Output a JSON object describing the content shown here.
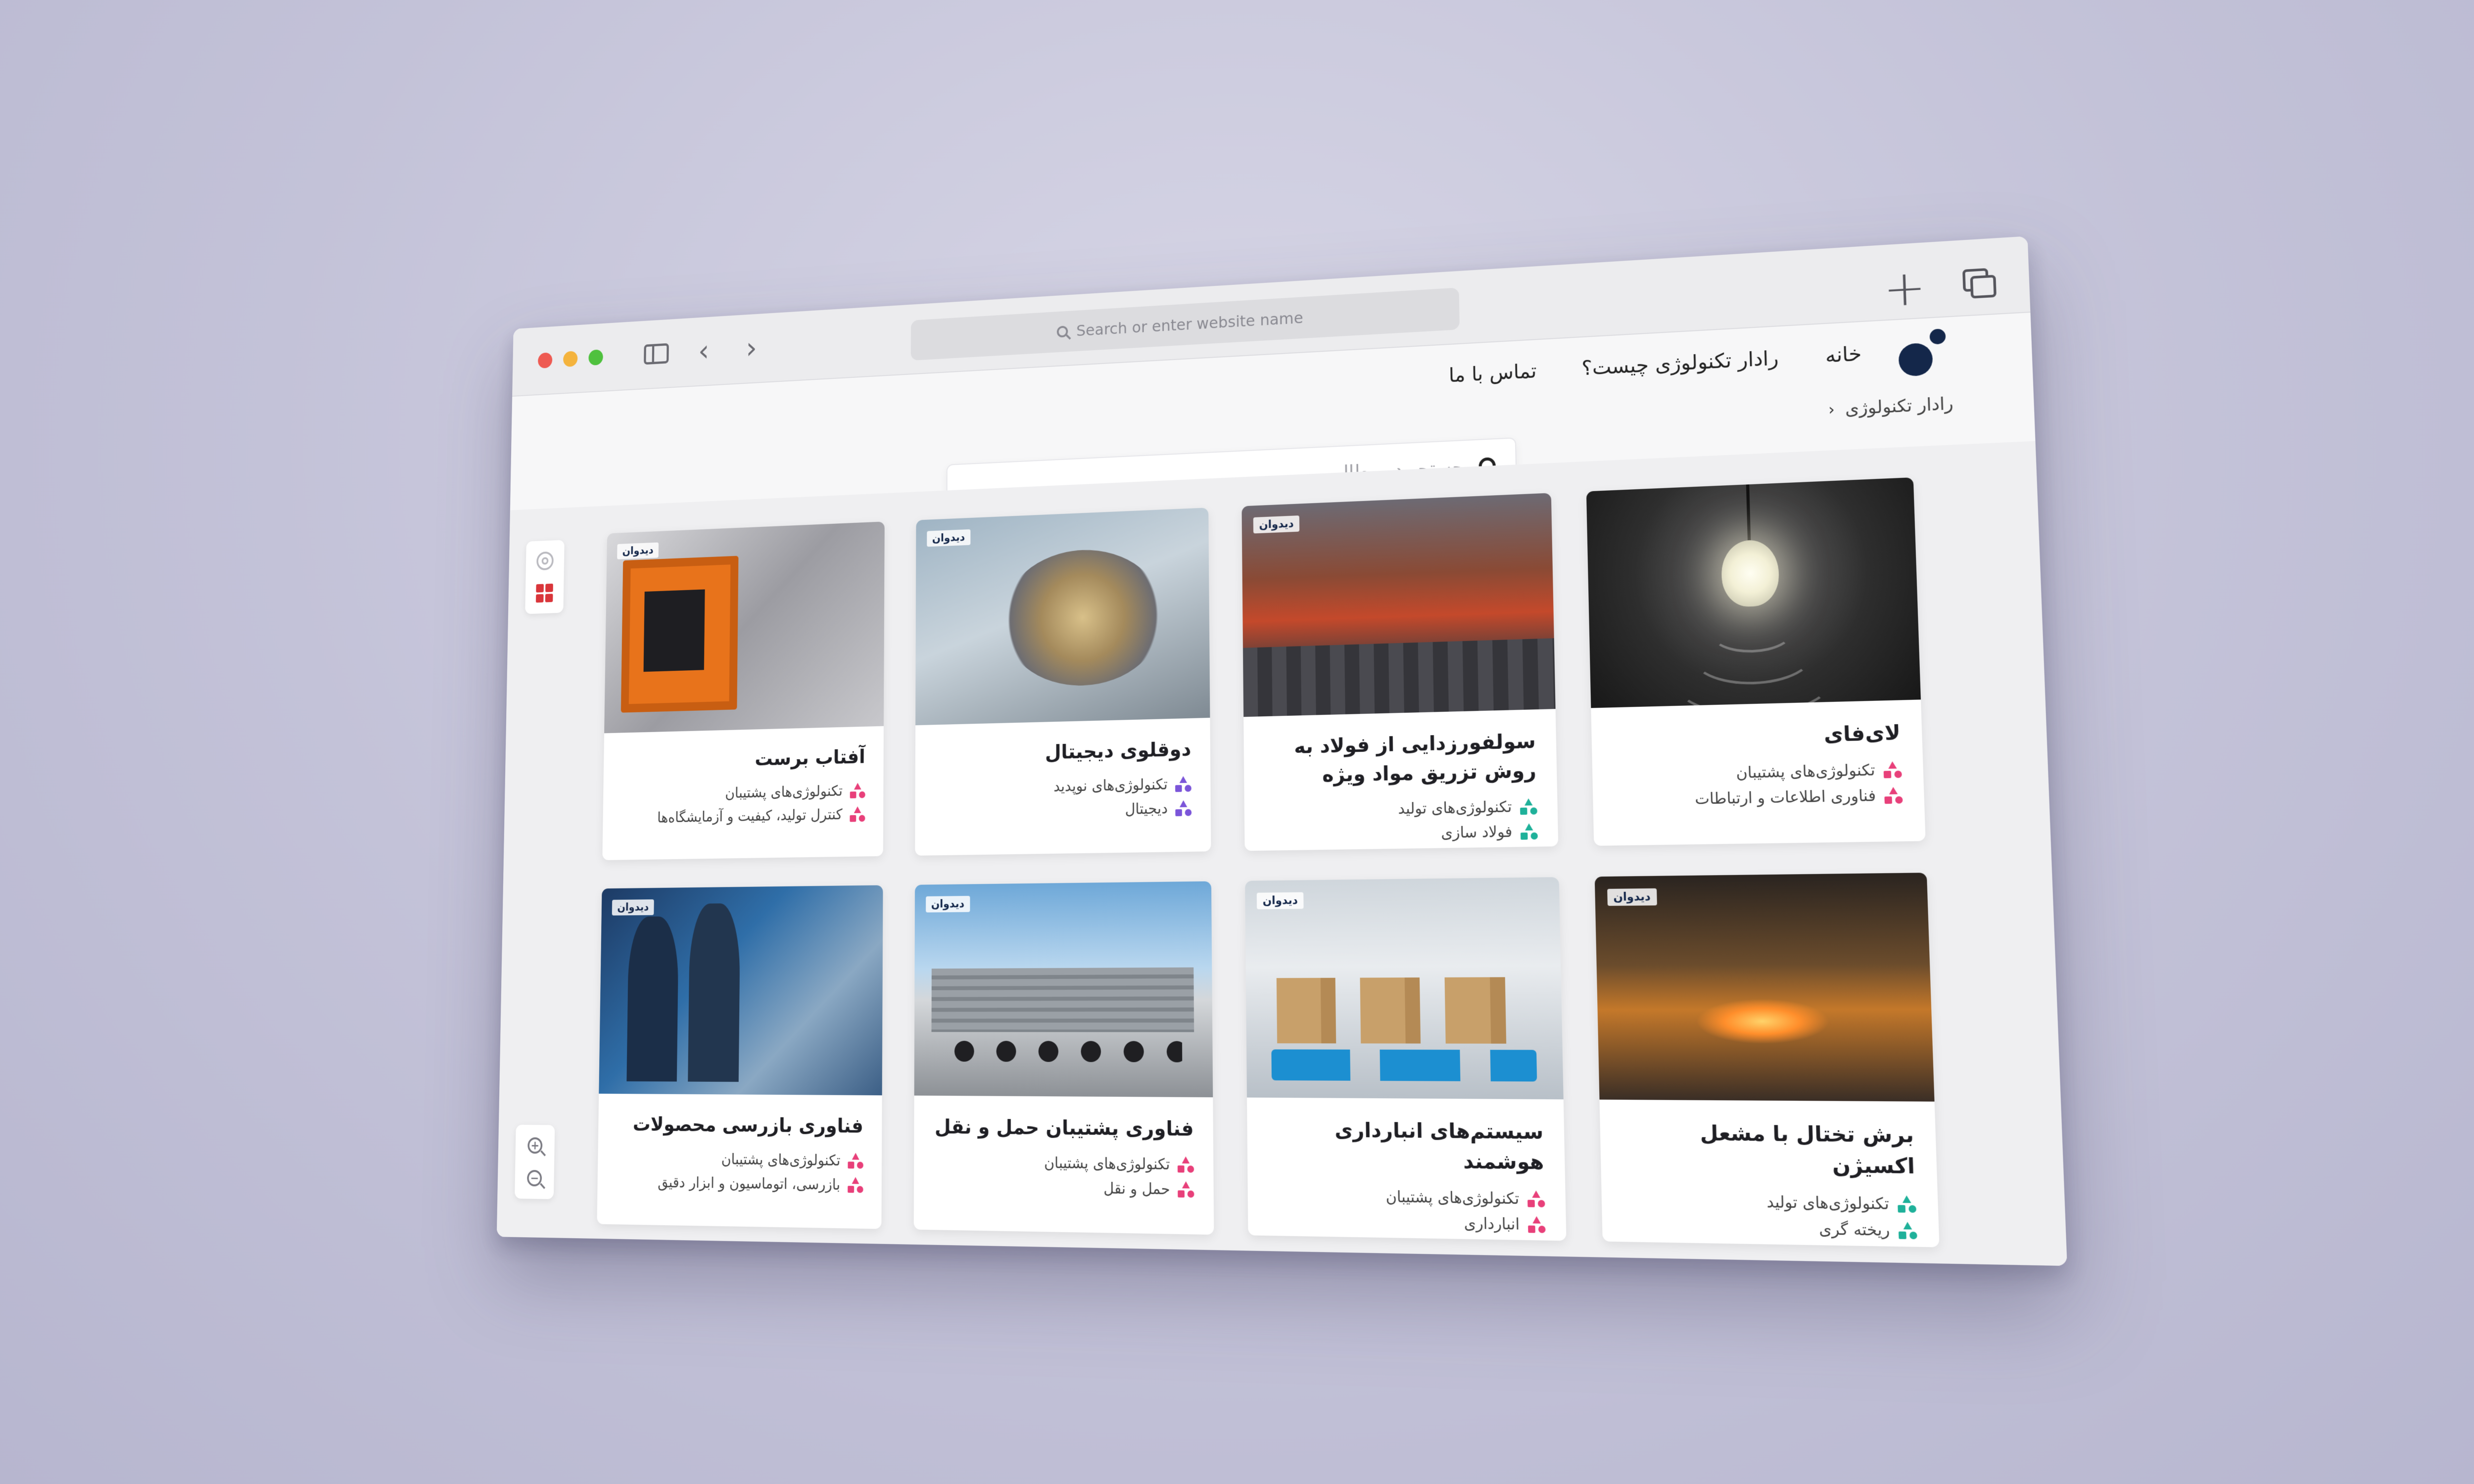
{
  "browser": {
    "url_placeholder": "Search or enter website name",
    "icons": [
      "sidebar-icon",
      "back-icon",
      "forward-icon",
      "new-tab-icon",
      "tabs-overview-icon"
    ]
  },
  "site": {
    "nav": {
      "home": "خانه",
      "what_is": "رادار تکنولوژی چیست؟",
      "contact": "تماس با ما"
    },
    "breadcrumb": "رادار تکنولوژی",
    "search_placeholder": "جستجو در مطالب...",
    "thumb_tag": "دیدوان"
  },
  "colors": {
    "pink": "#e8407a",
    "purple": "#7b55d9",
    "teal": "#1fb19a",
    "brand": "#14274a",
    "accent_red": "#d9353a"
  },
  "cards": [
    {
      "title": "لای‌فای",
      "tags": [
        "تکنولوژی‌های پشتیبان",
        "فناوری اطلاعات و ارتباطات"
      ],
      "tag_color": "pink"
    },
    {
      "title": "سولفورزدایی از فولاد به روش تزریق مواد ویژه",
      "tags": [
        "تکنولوژی‌های تولید",
        "فولاد سازی"
      ],
      "tag_color": "teal"
    },
    {
      "title": "دوقلوی دیجیتال",
      "tags": [
        "تکنولوژی‌های نوپدید",
        "دیجیتال"
      ],
      "tag_color": "purple"
    },
    {
      "title": "آفتاب برست",
      "tags": [
        "تکنولوژی‌های پشتیبان",
        "کنترل تولید، کیفیت و آزمایشگاه‌ها"
      ],
      "tag_color": "pink"
    },
    {
      "title": "برش تختال با مشعل اکسیژن",
      "tags": [
        "تکنولوژی‌های تولید",
        "ریخته گری"
      ],
      "tag_color": "teal"
    },
    {
      "title": "سیستم‌های انبارداری هوشمند",
      "tags": [
        "تکنولوژی‌های پشتیبان",
        "انبارداری"
      ],
      "tag_color": "pink"
    },
    {
      "title": "فناوری پشتیبان حمل و نقل",
      "tags": [
        "تکنولوژی‌های پشتیبان",
        "حمل و نقل"
      ],
      "tag_color": "pink"
    },
    {
      "title": "فناوری بازرسی محصولات",
      "tags": [
        "تکنولوژی‌های پشتیبان",
        "بازرسی، اتوماسیون و ابزار دقیق"
      ],
      "tag_color": "pink"
    }
  ]
}
